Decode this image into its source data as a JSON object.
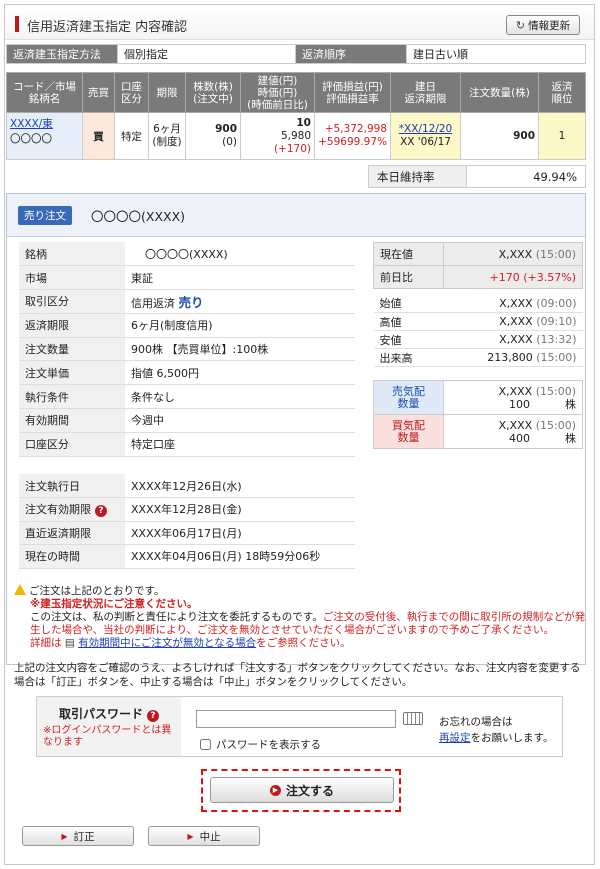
{
  "header": {
    "title": "信用返済建玉指定 内容確認",
    "refresh_label": "情報更新"
  },
  "info": {
    "method_label": "返済建玉指定方法",
    "method_value": "個別指定",
    "order_label": "返済順序",
    "order_value": "建日古い順"
  },
  "positions": {
    "headers": [
      "コード／市場\n銘柄名",
      "売買",
      "口座\n区分",
      "期限",
      "株数(株)\n(注文中)",
      "建値(円)\n時価(円)\n(時価前日比)",
      "評価損益(円)\n評価損益率",
      "建日\n返済期限",
      "注文数量(株)",
      "返済\n順位"
    ],
    "row": {
      "code": "XXXX/東",
      "name": "〇〇〇〇",
      "side": "買",
      "account": "特定",
      "term1": "6ヶ月",
      "term2": "(制度)",
      "shares": "900",
      "shares_pending": "(0)",
      "entry_price": "10",
      "current_price": "5,980",
      "change": "(+170)",
      "pl": "+5,372,998",
      "pl_rate": "+59699.97%",
      "open_date": "*XX/12/20",
      "due_date": "XX '06/17",
      "order_qty": "900",
      "rank": "1"
    }
  },
  "rate": {
    "label": "本日維持率",
    "value": "49.94%"
  },
  "order": {
    "badge": "売り注文",
    "name": "〇〇〇〇(XXXX)",
    "details": [
      {
        "k": "銘柄",
        "v": "〇〇〇〇(XXXX)"
      },
      {
        "k": "市場",
        "v": "東証"
      },
      {
        "k": "取引区分",
        "v": "信用返済",
        "v2": "売り"
      },
      {
        "k": "返済期限",
        "v": "6ヶ月(制度信用)"
      },
      {
        "k": "注文数量",
        "v": "900株 【売買単位】:100株"
      },
      {
        "k": "注文単価",
        "v": "指値 6,500円"
      },
      {
        "k": "執行条件",
        "v": "条件なし"
      },
      {
        "k": "有効期間",
        "v": "今週中"
      },
      {
        "k": "口座区分",
        "v": "特定口座"
      }
    ],
    "dates": [
      {
        "k": "注文執行日",
        "v": "XXXX年12月26日(水)"
      },
      {
        "k": "注文有効期限",
        "v": "XXXX年12月28日(金)"
      },
      {
        "k": "直近返済期限",
        "v": "XXXX年06月17日(月)"
      },
      {
        "k": "現在の時間",
        "v": "XXXX年04月06日(月) 18時59分06秒"
      }
    ]
  },
  "quote": {
    "current": {
      "label": "現在値",
      "value": "X,XXX",
      "time": "(15:00)"
    },
    "prev": {
      "label": "前日比",
      "value": "+170 (+3.57%)"
    },
    "ohlc": [
      {
        "label": "始値",
        "value": "X,XXX",
        "time": "(09:00)"
      },
      {
        "label": "高値",
        "value": "X,XXX",
        "time": "(09:10)"
      },
      {
        "label": "安値",
        "value": "X,XXX",
        "time": "(13:32)"
      },
      {
        "label": "出来高",
        "value": "213,800",
        "time": "(15:00)"
      }
    ],
    "sell": {
      "label1": "売気配",
      "label2": "数量",
      "price": "X,XXX",
      "time": "(15:00)",
      "qty": "100",
      "unit": "株"
    },
    "buy": {
      "label1": "買気配",
      "label2": "数量",
      "price": "X,XXX",
      "time": "(15:00)",
      "qty": "400",
      "unit": "株"
    }
  },
  "warning": {
    "line1": "ご注文は上記のとおりです。",
    "line2": "※建玉指定状況にご注意ください。",
    "line3a": "この注文は、私の判断と責任により注文を委託するものです。",
    "line3b": "ご注文の受付後、執行までの間に取引所の規制などが発生した場合や、当社の判断により、ご注文を無効とさせていただく場合がございますので予めご了承ください。",
    "line4a": "詳細は",
    "line4link": "有効期間中にご注文が無効となる場合",
    "line4b": "をご参照ください。"
  },
  "note": "上記の注文内容をご確認のうえ、よろしければ「注文する」ボタンをクリックしてください。なお、注文内容を変更する場合は「訂正」ボタンを、中止する場合は「中止」ボタンをクリックしてください。",
  "password": {
    "label": "取引パスワード",
    "sub": "※ログインパスワードとは異なります",
    "show_label": "パスワードを表示する",
    "forgot1": "お忘れの場合は",
    "forgot_link": "再設定",
    "forgot2": "をお願いします。"
  },
  "buttons": {
    "submit": "注文する",
    "correct": "訂正",
    "cancel": "中止"
  }
}
